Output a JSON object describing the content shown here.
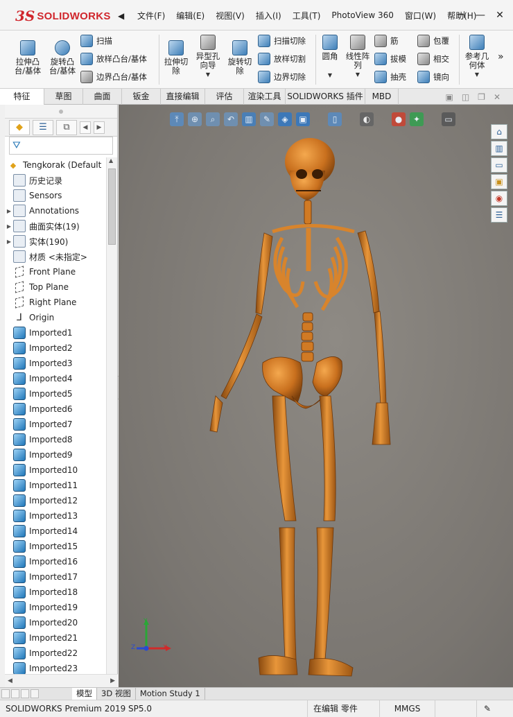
{
  "app": {
    "logo_mark": "3S",
    "logo_text": "SOLIDWORKS"
  },
  "menu": {
    "items": [
      "文件(F)",
      "编辑(E)",
      "视图(V)",
      "插入(I)",
      "工具(T)",
      "PhotoView 360",
      "窗口(W)",
      "帮助(H)"
    ],
    "pin": "⊣",
    "minimize": "—",
    "close": "✕"
  },
  "ribbon": {
    "extrude_boss": "拉伸凸\n台/基体",
    "revolve_boss": "旋转凸\n台/基体",
    "sweep": "扫描",
    "loft_boss": "放样凸台/基体",
    "boundary_boss": "边界凸台/基体",
    "extrude_cut": "拉伸切\n除",
    "hole_wizard": "异型孔\n向导",
    "revolve_cut": "旋转切\n除",
    "swept_cut": "扫描切除",
    "lofted_cut": "放样切割",
    "boundary_cut": "边界切除",
    "fillet": "圆角",
    "linear_pattern": "线性阵\n列",
    "rib": "筋",
    "draft": "拔模",
    "shell": "抽壳",
    "wrap": "包覆",
    "intersect": "相交",
    "mirror": "镜向",
    "reference_geometry": "参考几\n何体",
    "more": "»"
  },
  "cm_tabs": [
    "特征",
    "草图",
    "曲面",
    "钣金",
    "直接编辑",
    "评估",
    "渲染工具",
    "SOLIDWORKS 插件",
    "MBD"
  ],
  "feature_tree": {
    "root": "Tengkorak  (Default",
    "items": [
      {
        "label": "历史记录",
        "icon": "history-icon",
        "expand": ""
      },
      {
        "label": "Sensors",
        "icon": "sensors-icon",
        "expand": ""
      },
      {
        "label": "Annotations",
        "icon": "annotations-icon",
        "expand": "▶"
      },
      {
        "label": "曲面实体(19)",
        "icon": "surface-bodies-icon",
        "expand": "▶"
      },
      {
        "label": "实体(190)",
        "icon": "solid-bodies-icon",
        "expand": "▶"
      },
      {
        "label": "材质 <未指定>",
        "icon": "material-icon",
        "expand": ""
      },
      {
        "label": "Front Plane",
        "icon": "plane-icon",
        "expand": ""
      },
      {
        "label": "Top Plane",
        "icon": "plane-icon",
        "expand": ""
      },
      {
        "label": "Right Plane",
        "icon": "plane-icon",
        "expand": ""
      },
      {
        "label": "Origin",
        "icon": "origin-icon",
        "expand": ""
      },
      {
        "label": "Imported1",
        "icon": "imported-body-icon",
        "expand": ""
      },
      {
        "label": "Imported2",
        "icon": "imported-body-icon",
        "expand": ""
      },
      {
        "label": "Imported3",
        "icon": "imported-body-icon",
        "expand": ""
      },
      {
        "label": "Imported4",
        "icon": "imported-body-icon",
        "expand": ""
      },
      {
        "label": "Imported5",
        "icon": "imported-body-icon",
        "expand": ""
      },
      {
        "label": "Imported6",
        "icon": "imported-body-icon",
        "expand": ""
      },
      {
        "label": "Imported7",
        "icon": "imported-body-icon",
        "expand": ""
      },
      {
        "label": "Imported8",
        "icon": "imported-body-icon",
        "expand": ""
      },
      {
        "label": "Imported9",
        "icon": "imported-body-icon",
        "expand": ""
      },
      {
        "label": "Imported10",
        "icon": "imported-body-icon",
        "expand": ""
      },
      {
        "label": "Imported11",
        "icon": "imported-body-icon",
        "expand": ""
      },
      {
        "label": "Imported12",
        "icon": "imported-body-icon",
        "expand": ""
      },
      {
        "label": "Imported13",
        "icon": "imported-body-icon",
        "expand": ""
      },
      {
        "label": "Imported14",
        "icon": "imported-body-icon",
        "expand": ""
      },
      {
        "label": "Imported15",
        "icon": "imported-body-icon",
        "expand": ""
      },
      {
        "label": "Imported16",
        "icon": "imported-body-icon",
        "expand": ""
      },
      {
        "label": "Imported17",
        "icon": "imported-body-icon",
        "expand": ""
      },
      {
        "label": "Imported18",
        "icon": "imported-body-icon",
        "expand": ""
      },
      {
        "label": "Imported19",
        "icon": "imported-body-icon",
        "expand": ""
      },
      {
        "label": "Imported20",
        "icon": "imported-body-icon",
        "expand": ""
      },
      {
        "label": "Imported21",
        "icon": "imported-body-icon",
        "expand": ""
      },
      {
        "label": "Imported22",
        "icon": "imported-body-icon",
        "expand": ""
      },
      {
        "label": "Imported23",
        "icon": "imported-body-icon",
        "expand": ""
      }
    ]
  },
  "triad": {
    "x": "X",
    "y": "Y",
    "z": "Z"
  },
  "bottom_tabs": [
    "模型",
    "3D 视图",
    "Motion Study 1"
  ],
  "status": {
    "product": "SOLIDWORKS Premium 2019 SP5.0",
    "mode": "在编辑 零件",
    "units": "MMGS"
  },
  "colors": {
    "brand_red": "#d0262c",
    "viewport_bg": "#7f7b76",
    "bone": "#c8741c"
  }
}
